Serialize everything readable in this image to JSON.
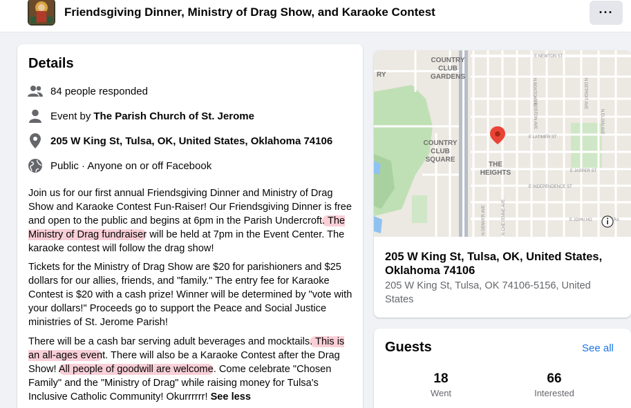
{
  "header": {
    "title": "Friendsgiving Dinner, Ministry of Drag Show, and Karaoke Contest",
    "more_label": "···"
  },
  "details": {
    "heading": "Details",
    "responded": "84 people responded",
    "event_by_prefix": "Event by ",
    "event_by_name": "The Parish Church of St. Jerome",
    "address": "205 W King St, Tulsa, OK, United States, Oklahoma 74106",
    "privacy": "Public · Anyone on or off Facebook",
    "p1_a": "Join us for our first annual Friendsgiving Dinner and Ministry of Drag Show and Karaoke Contest Fun-Raiser! Our Friendsgiving Dinner is free and open to the public and begins at 6pm in the Parish Undercroft",
    "p1_hl": ". The Ministry of Drag fundraiser",
    "p1_b": " will be held at 7pm in the Event Center. The karaoke contest will follow the drag show!",
    "p2": "Tickets for the Ministry of Drag Show are $20 for parishioners and $25 dollars for our allies, friends, and \"family.\" The entry fee for Karaoke Contest is $20 with a cash prize! Winner will be determined by \"vote with your dollars!\" Proceeds go to support the Peace and Social Justice ministries of St. Jerome Parish!",
    "p3_a": "There will be a cash bar serving adult beverages and mocktails",
    "p3_hl1": ". This is an all-ages even",
    "p3_b": "t. There will also be a Karaoke Contest after the Drag Show! ",
    "p3_hl2": "All people of goodwill are welcome",
    "p3_c": ". Come celebrate \"Chosen Family\" and the \"Ministry of Drag\" while raising money for Tulsa's Inclusive Catholic Community! Okurrrrrr! ",
    "see_less": "See less"
  },
  "map": {
    "labels": {
      "country_club_gardens": [
        "COUNTRY",
        "CLUB",
        "GARDENS"
      ],
      "country_club_square": [
        "COUNTRY",
        "CLUB",
        "SQUARE"
      ],
      "the_heights": [
        "THE",
        "HEIGHTS"
      ],
      "e_newton": "E NEWTON ST",
      "e_latimer": "E LATIMER ST",
      "e_jasper": "E JASPER ST",
      "e_independence": "E INDEPENDENCE ST",
      "e_john_hope": "E JOHN HO",
      "n_boston_pl": "N BOSTON PL",
      "n_boston_ave": "N BOSTON AVE",
      "n_detroit_ave": "N DETROIT AVE",
      "n_elgin_ave": "N ELGIN AVE",
      "n_denver_ave": "N DENVER AVE",
      "n_cheyenne_ave": "N CHEYENNE AVE",
      "ry": "RY",
      "tra": "TRA"
    }
  },
  "location": {
    "title": "205 W King St, Tulsa, OK, United States, Oklahoma 74106",
    "subtitle": "205 W King St, Tulsa, OK 74106-5156, United States"
  },
  "guests": {
    "heading": "Guests",
    "see_all": "See all",
    "went_count": "18",
    "went_label": "Went",
    "interested_count": "66",
    "interested_label": "Interested"
  },
  "colors": {
    "accent": "#1b74e4",
    "highlight": "#f08296",
    "map_pin": "#ea4335"
  }
}
